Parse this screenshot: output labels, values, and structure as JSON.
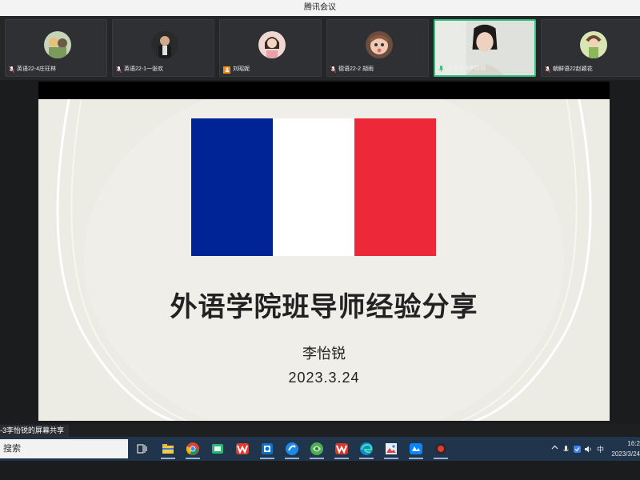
{
  "window": {
    "title": "腾讯会议"
  },
  "participants": [
    {
      "name": "英语22-4庄玨林",
      "mic": "muted"
    },
    {
      "name": "英语22-1一张欢",
      "mic": "muted"
    },
    {
      "name": "刘昭妮",
      "mic": "user-badge"
    },
    {
      "name": "德语22-2 胡雨",
      "mic": "muted"
    },
    {
      "name": "法语22-3李怡锐",
      "mic": "speaking"
    },
    {
      "name": "朝鲜语22赵颖花",
      "mic": "muted"
    }
  ],
  "slide": {
    "title": "外语学院班导师经验分享",
    "author": "李怡锐",
    "date": "2023.3.24",
    "flag_colors": [
      "#002395",
      "#ffffff",
      "#ed2939"
    ]
  },
  "share_label": "-3李怡锐的屏幕共享",
  "taskbar": {
    "search_label": "搜索",
    "apps": [
      "task-view-icon",
      "file-explorer-icon",
      "chrome-icon",
      "green-app-icon",
      "wps-icon",
      "outlook-icon",
      "sync-icon",
      "browser-icon",
      "wps-office-icon",
      "edge-icon",
      "picture-app-icon",
      "tencent-meeting-icon",
      "record-icon"
    ],
    "ime": "中",
    "clock_time": "16:2",
    "clock_date": "2023/3/24"
  }
}
